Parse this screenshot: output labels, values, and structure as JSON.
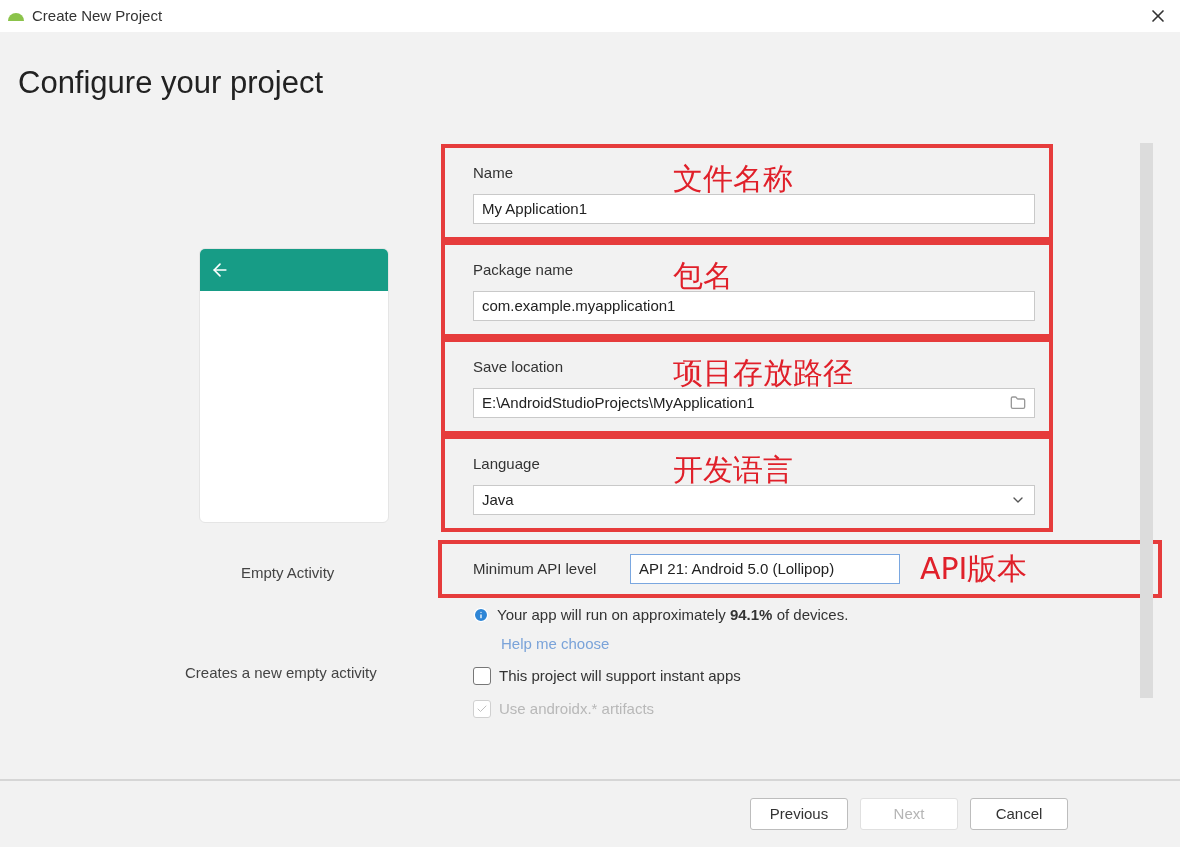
{
  "window": {
    "title": "Create New Project"
  },
  "heading": "Configure your project",
  "template": {
    "name": "Empty Activity",
    "description": "Creates a new empty activity"
  },
  "fields": [
    {
      "kind": "text",
      "label": "Name",
      "value": "My Application1",
      "annotation": "文件名称"
    },
    {
      "kind": "text",
      "label": "Package name",
      "value": "com.example.myapplication1",
      "annotation": "包名"
    },
    {
      "kind": "folder",
      "label": "Save location",
      "value": "E:\\AndroidStudioProjects\\MyApplication1",
      "annotation": "项目存放路径"
    },
    {
      "kind": "dropdown",
      "label": "Language",
      "value": "Java",
      "annotation": "开发语言"
    }
  ],
  "api": {
    "label": "Minimum API level",
    "value": "API 21: Android 5.0 (Lollipop)",
    "annotation": "API版本"
  },
  "info": "Your app will run on approximately **94.1%** of devices.",
  "help_link": "Help me choose",
  "options": [
    {
      "label": "This project will support instant apps",
      "checked": false,
      "disabled": false
    },
    {
      "label": "Use androidx.* artifacts",
      "checked": true,
      "disabled": true
    }
  ],
  "buttons": [
    {
      "label": "Previous",
      "disabled": false
    },
    {
      "label": "Next",
      "disabled": true
    },
    {
      "label": "Cancel",
      "disabled": false
    }
  ]
}
